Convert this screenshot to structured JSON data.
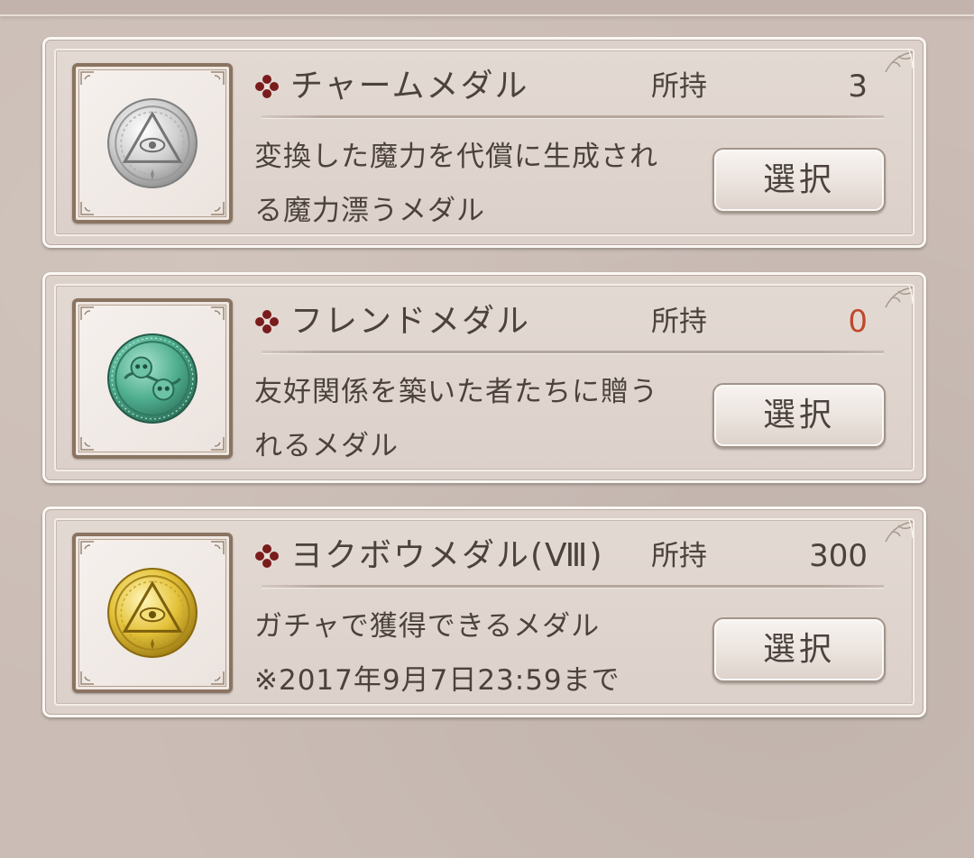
{
  "colors": {
    "background": "#cbbdb5",
    "text": "#4b423d",
    "zero_count": "#c0492c",
    "frame": "#8a7461",
    "title_icon": "#7a1c1c"
  },
  "medals": [
    {
      "icon": "silver-eye-medal",
      "title": "チャームメダル",
      "owned_label": "所持",
      "owned_count": "3",
      "desc_lines": [
        "変換した魔力を代償に生成され",
        "る魔力漂うメダル"
      ],
      "button_label": "選択"
    },
    {
      "icon": "green-friend-medal",
      "title": "フレンドメダル",
      "owned_label": "所持",
      "owned_count": "0",
      "desc_lines": [
        "友好関係を築いた者たちに贈う",
        "れるメダル"
      ],
      "button_label": "選択"
    },
    {
      "icon": "gold-eye-medal",
      "title": "ヨクボウメダル(Ⅷ)",
      "owned_label": "所持",
      "owned_count": "300",
      "desc_lines": [
        "ガチャで獲得できるメダル",
        "※2017年9月7日23:59まで"
      ],
      "button_label": "選択"
    }
  ]
}
